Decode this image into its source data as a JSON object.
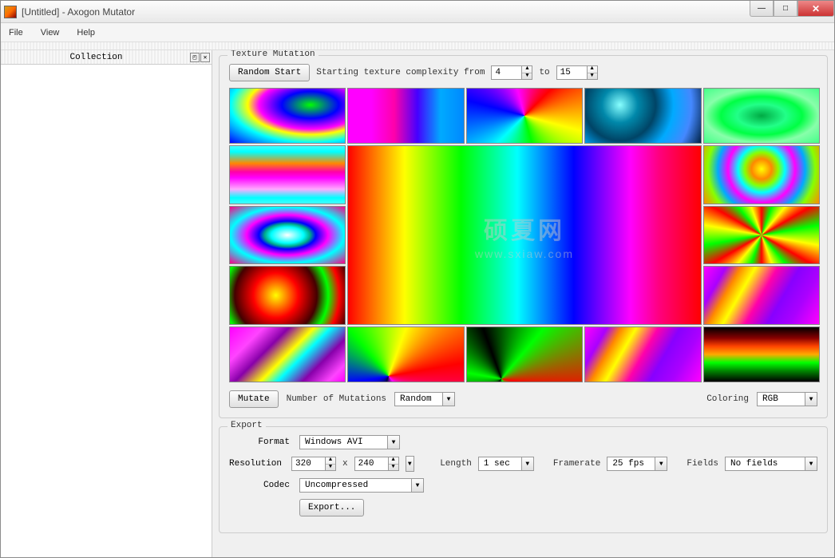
{
  "window": {
    "title": "[Untitled] - Axogon Mutator"
  },
  "menus": {
    "file": "File",
    "view": "View",
    "help": "Help"
  },
  "sidebar": {
    "title": "Collection"
  },
  "texture": {
    "group_title": "Texture Mutation",
    "random_start": "Random Start",
    "complexity_label": "Starting texture complexity from",
    "complexity_from": "4",
    "to_label": "to",
    "complexity_to": "15",
    "mutate": "Mutate",
    "num_mutations_label": "Number of Mutations",
    "num_mutations_value": "Random",
    "coloring_label": "Coloring",
    "coloring_value": "RGB"
  },
  "watermark": {
    "main": "硕夏网",
    "sub": "www.sxiaw.com"
  },
  "export": {
    "group_title": "Export",
    "format_label": "Format",
    "format_value": "Windows AVI",
    "resolution_label": "Resolution",
    "res_w": "320",
    "res_x": "x",
    "res_h": "240",
    "length_label": "Length",
    "length_value": "1 sec",
    "framerate_label": "Framerate",
    "framerate_value": "25 fps",
    "fields_label": "Fields",
    "fields_value": "No fields",
    "codec_label": "Codec",
    "codec_value": "Uncompressed",
    "export_btn": "Export..."
  }
}
